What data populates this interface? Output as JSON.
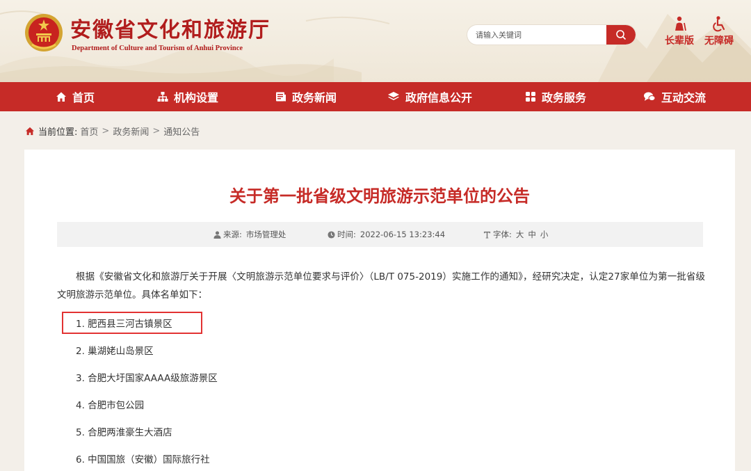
{
  "header": {
    "title": "安徽省文化和旅游厅",
    "subtitle": "Department of Culture and Tourism of Anhui Province",
    "search": {
      "placeholder": "请输入关键词"
    },
    "tools": [
      {
        "label": "长辈版",
        "icon": "elder-icon"
      },
      {
        "label": "无障碍",
        "icon": "accessibility-icon"
      }
    ]
  },
  "nav": {
    "items": [
      {
        "label": "首页",
        "icon": "home-icon"
      },
      {
        "label": "机构设置",
        "icon": "org-chart-icon"
      },
      {
        "label": "政务新闻",
        "icon": "news-icon"
      },
      {
        "label": "政府信息公开",
        "icon": "layers-icon"
      },
      {
        "label": "政务服务",
        "icon": "grid-icon"
      },
      {
        "label": "互动交流",
        "icon": "chat-icon"
      }
    ]
  },
  "breadcrumb": {
    "label": "当前位置:",
    "items": [
      "首页",
      "政务新闻",
      "通知公告"
    ],
    "separator": ">"
  },
  "article": {
    "title": "关于第一批省级文明旅游示范单位的公告",
    "meta": {
      "source_label": "来源:",
      "source": "市场管理处",
      "time_label": "时间:",
      "time": "2022-06-15 13:23:44",
      "font_label": "字体:",
      "font_sizes": [
        "大",
        "中",
        "小"
      ]
    },
    "intro": "根据《安徽省文化和旅游厅关于开展〈文明旅游示范单位要求与评价〉（LB/T 075-2019）实施工作的通知》，经研究决定，认定27家单位为第一批省级文明旅游示范单位。具体名单如下：",
    "list": [
      "1. 肥西县三河古镇景区",
      "2. 巢湖姥山岛景区",
      "3. 合肥大圩国家AAAA级旅游景区",
      "4. 合肥市包公园",
      "5. 合肥两淮豪生大酒店",
      "6. 中国国旅（安徽）国际旅行社"
    ]
  },
  "colors": {
    "brand_red": "#c62b27",
    "highlight_red": "#e23232",
    "page_bg": "#f3efe9"
  }
}
